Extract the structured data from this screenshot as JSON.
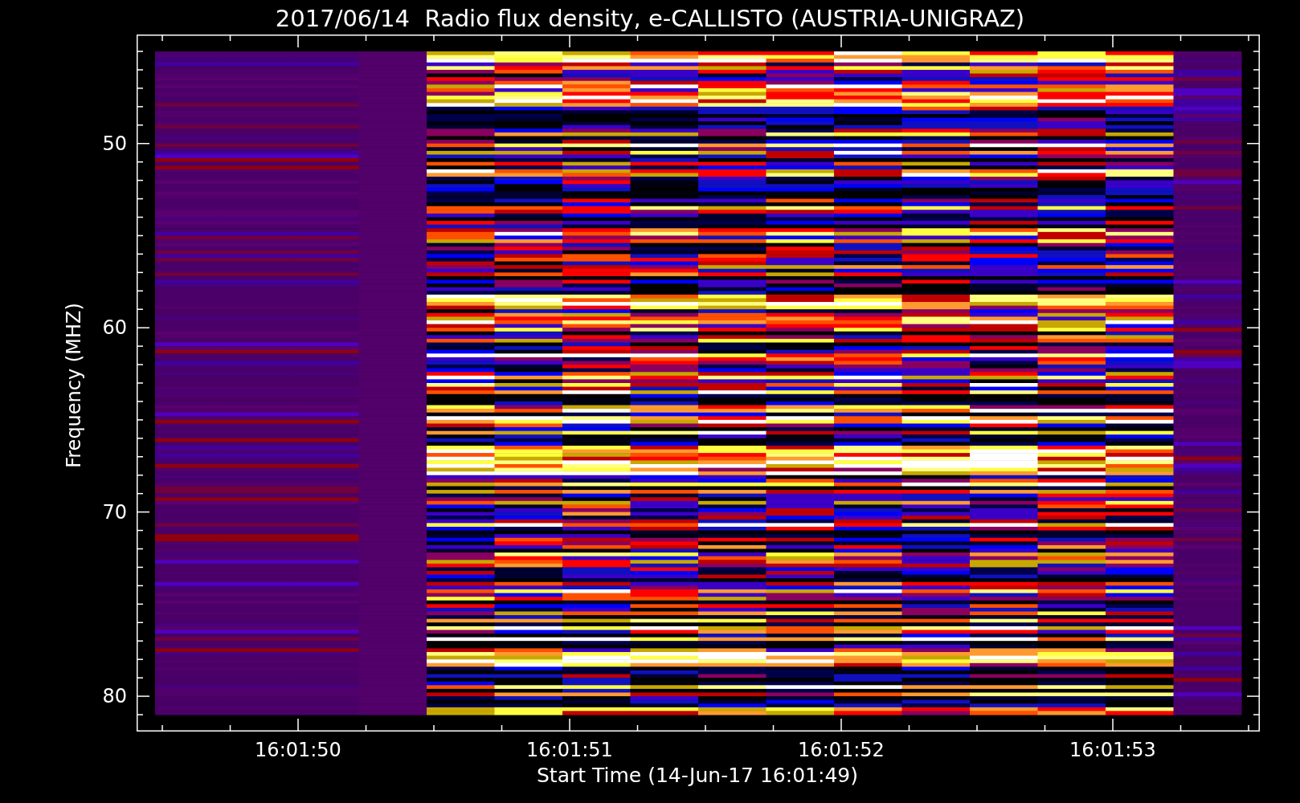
{
  "title": "2017/06/14  Radio flux density, e-CALLISTO (AUSTRIA-UNIGRAZ)",
  "y_axis": {
    "label": "Frequency (MHZ)",
    "ticks": [
      "50",
      "60",
      "70",
      "80"
    ]
  },
  "x_axis": {
    "label": "Start Time (14-Jun-17 16:01:49)",
    "ticks": [
      "16:01:50",
      "16:01:51",
      "16:01:52",
      "16:01:53"
    ]
  }
}
